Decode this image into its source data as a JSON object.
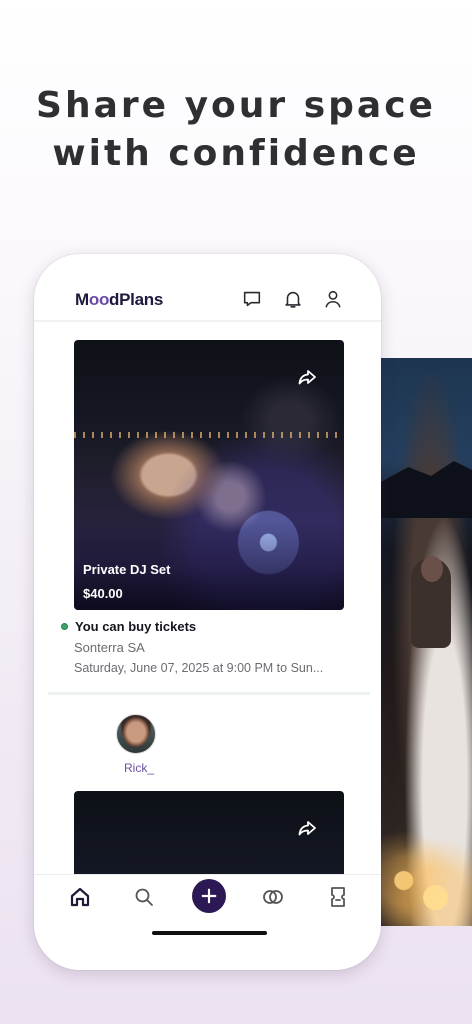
{
  "headline": {
    "line1": "Share your space",
    "line2": "with confidence"
  },
  "app": {
    "logo_prefix": "M",
    "logo_oo": "oo",
    "logo_suffix": "dPlans",
    "header_icons": [
      "message-icon",
      "bell-icon",
      "profile-icon"
    ]
  },
  "event": {
    "name": "Private DJ Set",
    "price": "$40.00",
    "status": "You can buy tickets",
    "venue": "Sonterra SA",
    "datetime": "Saturday, June 07, 2025 at 9:00 PM to Sun..."
  },
  "post": {
    "username": "Rick_"
  },
  "tabbar": {
    "items": [
      "home-icon",
      "search-icon",
      "add-icon",
      "links-icon",
      "tickets-icon"
    ]
  },
  "colors": {
    "brand_dark": "#1d1a3b",
    "brand_accent": "#6c4aa6",
    "fab": "#2b1854",
    "status_green": "#3aa56b"
  }
}
